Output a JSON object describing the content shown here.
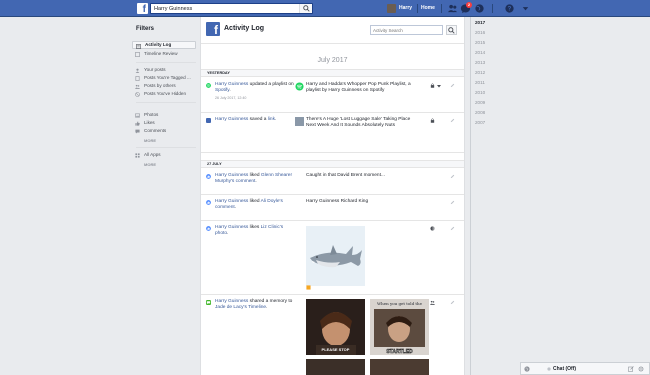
{
  "topbar": {
    "search_value": "Harry Guinness",
    "user_name": "Harry",
    "home_label": "Home",
    "notification_count": "2",
    "brand_color": "#4267b2"
  },
  "filters": {
    "title": "Filters",
    "items": [
      {
        "label": "Activity Log",
        "icon": "activity-log-icon",
        "active": true
      },
      {
        "label": "Timeline Review",
        "icon": "timeline-review-icon"
      },
      {
        "label": "Your posts",
        "icon": "person-icon"
      },
      {
        "label": "Posts You're Tagged ...",
        "icon": "tag-icon"
      },
      {
        "label": "Posts by others",
        "icon": "people-icon"
      },
      {
        "label": "Posts You've Hidden",
        "icon": "hidden-icon"
      },
      {
        "label": "Photos",
        "icon": "photo-icon"
      },
      {
        "label": "Likes",
        "icon": "like-icon"
      },
      {
        "label": "Comments",
        "icon": "comment-icon"
      },
      {
        "label": "All Apps",
        "icon": "apps-icon"
      }
    ],
    "more_label": "MORE"
  },
  "main": {
    "title": "Activity Log",
    "search_placeholder": "Activity Search",
    "month": "July 2017",
    "groups": [
      {
        "label": "YESTERDAY"
      },
      {
        "label": "27 JULY"
      }
    ],
    "entries": [
      {
        "actor": "Harry Guinness",
        "action": " updated a playlist on ",
        "object": "Spotify",
        "tail": ".",
        "meta": "26 July 2017, 12:40",
        "right": "Harry and Hadda's Whopper Pop Punk Playlist, a playlist by Harry Guinness on Spotify",
        "icon": "spotify-icon"
      },
      {
        "actor": "Harry Guinness",
        "action": " saved a ",
        "object": "link",
        "tail": ".",
        "right": "There's A Huge 'Lost Luggage Sale' Taking Place Next Week And It Sounds Absolutely Nuts",
        "icon": "facebook-icon"
      },
      {
        "actor": "Harry Guinness",
        "action": " liked ",
        "object": "Glenn Shearer Murphy's comment",
        "tail": ".",
        "right": "Caught in that David Brent moment...",
        "icon": "like-icon"
      },
      {
        "actor": "Harry Guinness",
        "action": " liked ",
        "object": "Ali Doyle's comment",
        "tail": ".",
        "right": "Harry Guinness Richard King",
        "icon": "like-icon"
      },
      {
        "actor": "Harry Guinness",
        "action": " likes ",
        "object": "Liz Clinic's photo",
        "tail": ".",
        "icon": "like-icon"
      },
      {
        "actor": "Harry Guinness",
        "action": " shared a memory to ",
        "object": "Jade de Lacy's Timeline",
        "tail": ".",
        "icon": "memory-icon"
      }
    ],
    "photo_captions": [
      "When you get told the",
      "PLEASE STOP",
      "STARTLED"
    ]
  },
  "years": [
    "2017",
    "2016",
    "2015",
    "2014",
    "2013",
    "2012",
    "2011",
    "2010",
    "2009",
    "2008",
    "2007"
  ],
  "chat": {
    "label": "Chat (Off)"
  }
}
